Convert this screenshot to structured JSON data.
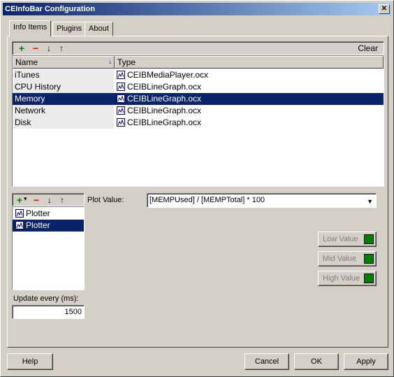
{
  "window": {
    "title": "CEInfoBar Configuration",
    "close_label": "✕"
  },
  "tabs": [
    {
      "label": "Info Items",
      "active": true
    },
    {
      "label": "Plugins",
      "active": false
    },
    {
      "label": "About",
      "active": false
    }
  ],
  "toolbar": {
    "add": "+",
    "remove": "−",
    "down": "↓",
    "up": "↑",
    "clear_label": "Clear"
  },
  "list": {
    "columns": [
      "Name",
      "Type"
    ],
    "rows": [
      {
        "name": "iTunes",
        "type": "CEIBMediaPlayer.ocx",
        "selected": false
      },
      {
        "name": "CPU History",
        "type": "CEIBLineGraph.ocx",
        "selected": false
      },
      {
        "name": "Memory",
        "type": "CEIBLineGraph.ocx",
        "selected": true
      },
      {
        "name": "Network",
        "type": "CEIBLineGraph.ocx",
        "selected": false
      },
      {
        "name": "Disk",
        "type": "CEIBLineGraph.ocx",
        "selected": false
      }
    ]
  },
  "plotter_toolbar": {
    "add": "+",
    "dropdown": "▾",
    "remove": "−",
    "down": "↓",
    "up": "↑"
  },
  "plotters": [
    {
      "label": "Plotter",
      "selected": false
    },
    {
      "label": "Plotter",
      "selected": true
    }
  ],
  "plot_value": {
    "label": "Plot Value:",
    "value": "[MEMPUsed] / [MEMPTotal] * 100",
    "arrow": "▼"
  },
  "color_buttons": {
    "low": "Low Value",
    "mid": "Mid Value",
    "high": "High Value",
    "swatch_color": "#008000"
  },
  "update": {
    "label": "Update every (ms):",
    "value": "1500"
  },
  "footer": {
    "help": "Help",
    "cancel": "Cancel",
    "ok": "OK",
    "apply": "Apply"
  },
  "colors": {
    "title_bar": "#0a246a",
    "selection": "#0a246a",
    "add_icon": "#008000",
    "remove_icon": "#ff0000"
  }
}
